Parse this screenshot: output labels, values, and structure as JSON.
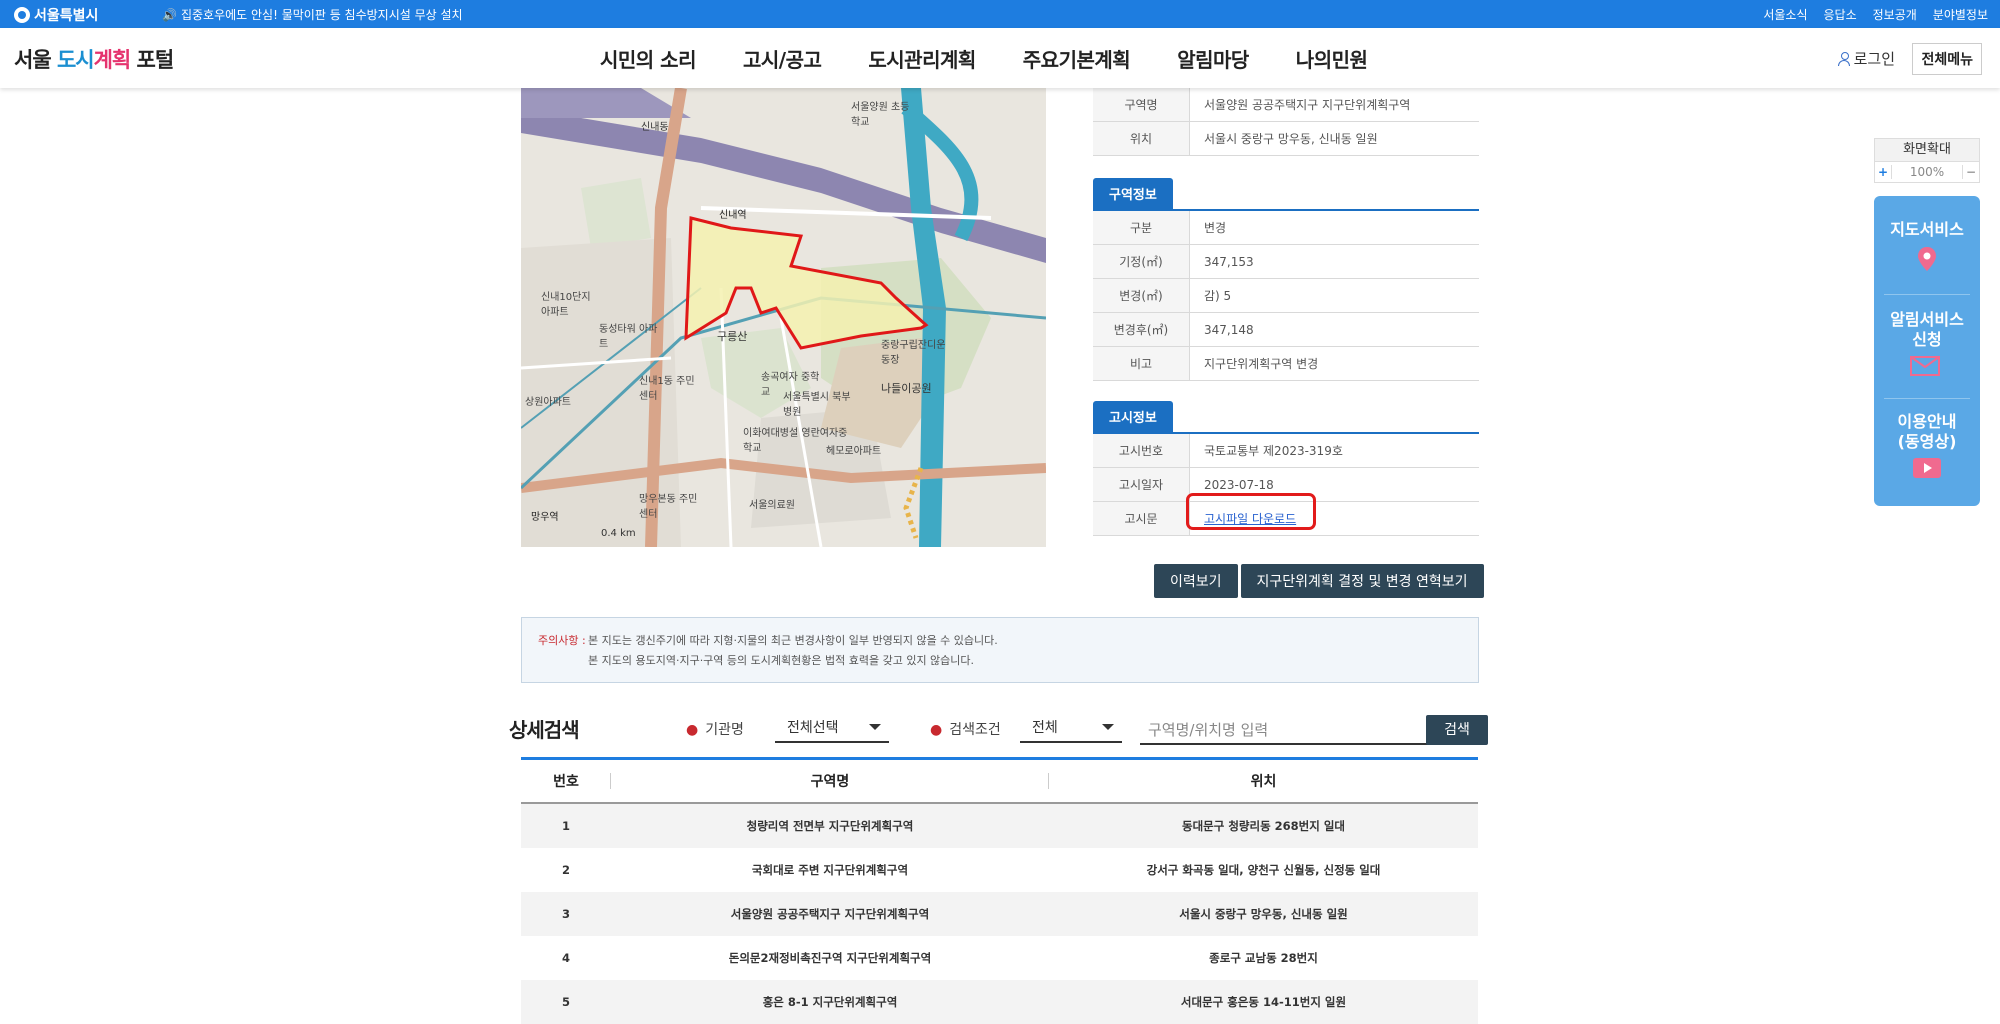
{
  "topbar": {
    "logo": "서울특별시",
    "notice": "집중호우에도 안심! 물막이판 등 침수방지시설 무상 설치",
    "links": [
      "서울소식",
      "응답소",
      "정보공개",
      "분야별정보"
    ]
  },
  "header": {
    "brand_a": "서울 ",
    "brand_b": "도시",
    "brand_c": "계획",
    "brand_d": " 포털",
    "nav": [
      "시민의 소리",
      "고시/공고",
      "도시관리계획",
      "주요기본계획",
      "알림마당",
      "나의민원"
    ],
    "login": "로그인",
    "all_menu": "전체메뉴"
  },
  "map": {
    "labels": [
      "신내역",
      "신내10단지 아파트",
      "동성타워 아파트",
      "신내1동 주민센터",
      "구릉산",
      "송곡여자 중학교",
      "이화여대병설 영란여자중학교",
      "망우본동 주민센터",
      "서울의료원",
      "서울특별시 북부병원",
      "서울양원 초등학교",
      "신내동",
      "중랑구립잔디운동장",
      "나들이공원",
      "헤모로아파트",
      "망우역",
      "상원아파트",
      "0.4 km"
    ]
  },
  "basic_info": [
    {
      "key": "구역명",
      "value": "서울양원 공공주택지구 지구단위계획구역"
    },
    {
      "key": "위치",
      "value": "서울시 중랑구 망우동, 신내동 일원"
    }
  ],
  "zone_info": {
    "tab": "구역정보",
    "rows": [
      {
        "key": "구분",
        "value": "변경"
      },
      {
        "key": "기정(㎡)",
        "value": "347,153"
      },
      {
        "key": "변경(㎡)",
        "value": "감) 5"
      },
      {
        "key": "변경후(㎡)",
        "value": "347,148"
      },
      {
        "key": "비고",
        "value": "지구단위계획구역 변경"
      }
    ]
  },
  "notice_info": {
    "tab": "고시정보",
    "rows": [
      {
        "key": "고시번호",
        "value": "국토교통부 제2023-319호"
      },
      {
        "key": "고시일자",
        "value": "2023-07-18"
      },
      {
        "key": "고시문",
        "value": "고시파일 다운로드"
      }
    ]
  },
  "buttons": {
    "history": "이력보기",
    "timeline": "지구단위계획 결정 및 변경 연혁보기"
  },
  "caution": {
    "title": "주의사항 :",
    "line1": "본 지도는 갱신주기에 따라 지형·지물의 최근 변경사항이 일부 반영되지 않을 수 있습니다.",
    "line2": "본 지도의 용도지역·지구·구역 등의 도시계획현황은 법적 효력을 갖고 있지 않습니다."
  },
  "search": {
    "title": "상세검색",
    "agency_label": "기관명",
    "agency_value": "전체선택",
    "cond_label": "검색조건",
    "cond_value": "전체",
    "placeholder": "구역명/위치명 입력",
    "button": "검색"
  },
  "results": {
    "headers": [
      "번호",
      "구역명",
      "위치"
    ],
    "rows": [
      {
        "no": "1",
        "name": "청량리역 전면부 지구단위계획구역",
        "loc": "동대문구 청량리동 268번지 일대"
      },
      {
        "no": "2",
        "name": "국회대로 주변 지구단위계획구역",
        "loc": "강서구 화곡동 일대, 양천구 신월동, 신정동 일대"
      },
      {
        "no": "3",
        "name": "서울양원 공공주택지구 지구단위계획구역",
        "loc": "서울시 중랑구 망우동, 신내동 일원"
      },
      {
        "no": "4",
        "name": "돈의문2재정비촉진구역 지구단위계획구역",
        "loc": "종로구 교남동 28번지"
      },
      {
        "no": "5",
        "name": "홍은 8-1 지구단위계획구역",
        "loc": "서대문구 홍은동 14-11번지 일원"
      }
    ]
  },
  "zoom": {
    "title": "화면확대",
    "value": "100%"
  },
  "quick_menu": {
    "map": "지도서비스",
    "alert_a": "알림서비스",
    "alert_b": "신청",
    "guide_a": "이용안내",
    "guide_b": "(동영상)"
  }
}
